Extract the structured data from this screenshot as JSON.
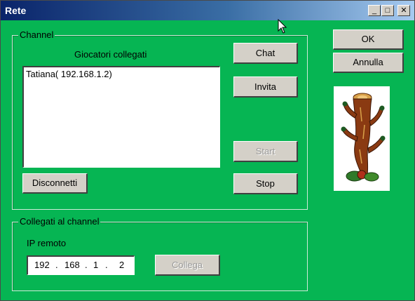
{
  "window": {
    "title": "Rete",
    "minimize": "_",
    "maximize": "□",
    "close": "✕"
  },
  "channel": {
    "group_label": "Channel",
    "players_label": "Giocatori collegati",
    "players": [
      "Tatiana( 192.168.1.2)"
    ],
    "buttons": {
      "chat": "Chat",
      "invite": "Invita",
      "start": "Start",
      "stop": "Stop",
      "disconnect": "Disconnetti"
    }
  },
  "connect": {
    "group_label": "Collegati al channel",
    "ip_label": "IP remoto",
    "ip": [
      "192",
      "168",
      "1",
      "2"
    ],
    "ip_sep": ".",
    "connect_button": "Collega"
  },
  "dialog_buttons": {
    "ok": "OK",
    "cancel": "Annulla"
  },
  "card": {
    "icon": "club-card-icon"
  },
  "colors": {
    "background": "#06b553",
    "button_face": "#d4d0c8",
    "title_start": "#0a246a",
    "title_end": "#a6caf0"
  }
}
